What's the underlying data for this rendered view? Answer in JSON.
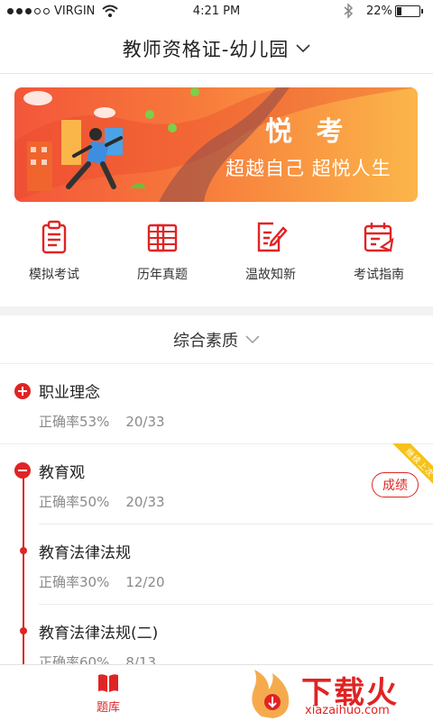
{
  "status_bar": {
    "carrier": "VIRGIN",
    "time": "4:21 PM",
    "battery_pct": "22%",
    "battery_level": 0.22,
    "signal_bars": 3,
    "icons": [
      "wifi-icon",
      "bluetooth-icon",
      "battery-icon"
    ]
  },
  "header": {
    "title": "教师资格证-幼儿园"
  },
  "banner": {
    "brand": "悦 考",
    "slogan": "超越自己 超悦人生"
  },
  "quick_entries": [
    {
      "label": "模拟考试",
      "icon": "exam-paper-icon"
    },
    {
      "label": "历年真题",
      "icon": "notebook-icon"
    },
    {
      "label": "温故知新",
      "icon": "edit-document-icon"
    },
    {
      "label": "考试指南",
      "icon": "calendar-guide-icon"
    }
  ],
  "subject": {
    "label": "综合素质"
  },
  "chapters": [
    {
      "name": "职业理念",
      "accuracy": "正确率53%",
      "progress": "20/33"
    },
    {
      "name": "教育观",
      "accuracy": "正确率50%",
      "progress": "20/33"
    },
    {
      "name": "教育法律法规",
      "accuracy": "正确率30%",
      "progress": "12/20"
    },
    {
      "name": "教育法律法规(二)",
      "accuracy": "正确率60%",
      "progress": "8/13"
    }
  ],
  "chapter_actions": {
    "score_label": "成绩",
    "ribbon_label": "继续上次"
  },
  "tabbar": {
    "active_label": "题库"
  },
  "watermark": {
    "text": "下载火",
    "url": "xiazaihuo.com"
  },
  "colors": {
    "accent": "#e02424",
    "banner_start": "#f3563a",
    "banner_end": "#fbb64a"
  }
}
